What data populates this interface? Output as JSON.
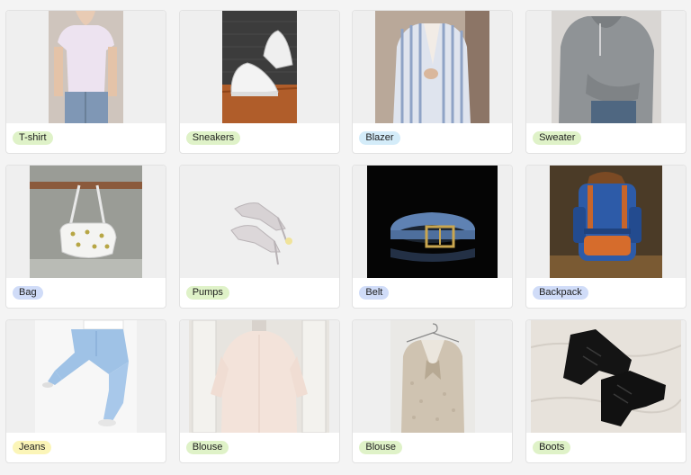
{
  "items": [
    {
      "label": "T-shirt",
      "tag_color": "#dff2c8",
      "icon": "tshirt-photo"
    },
    {
      "label": "Sneakers",
      "tag_color": "#dff2c8",
      "icon": "sneakers-photo"
    },
    {
      "label": "Blazer",
      "tag_color": "#d4ecf9",
      "icon": "blazer-photo"
    },
    {
      "label": "Sweater",
      "tag_color": "#dff2c8",
      "icon": "sweater-photo"
    },
    {
      "label": "Bag",
      "tag_color": "#d0dcf8",
      "icon": "bag-photo"
    },
    {
      "label": "Pumps",
      "tag_color": "#dff2c8",
      "icon": "pumps-photo"
    },
    {
      "label": "Belt",
      "tag_color": "#d0dcf8",
      "icon": "belt-photo"
    },
    {
      "label": "Backpack",
      "tag_color": "#d0dcf8",
      "icon": "backpack-photo"
    },
    {
      "label": "Jeans",
      "tag_color": "#fbf5b8",
      "icon": "jeans-photo"
    },
    {
      "label": "Blouse",
      "tag_color": "#dff2c8",
      "icon": "blouse-photo"
    },
    {
      "label": "Blouse",
      "tag_color": "#dff2c8",
      "icon": "blouse-photo"
    },
    {
      "label": "Boots",
      "tag_color": "#dff2c8",
      "icon": "boots-photo"
    }
  ]
}
